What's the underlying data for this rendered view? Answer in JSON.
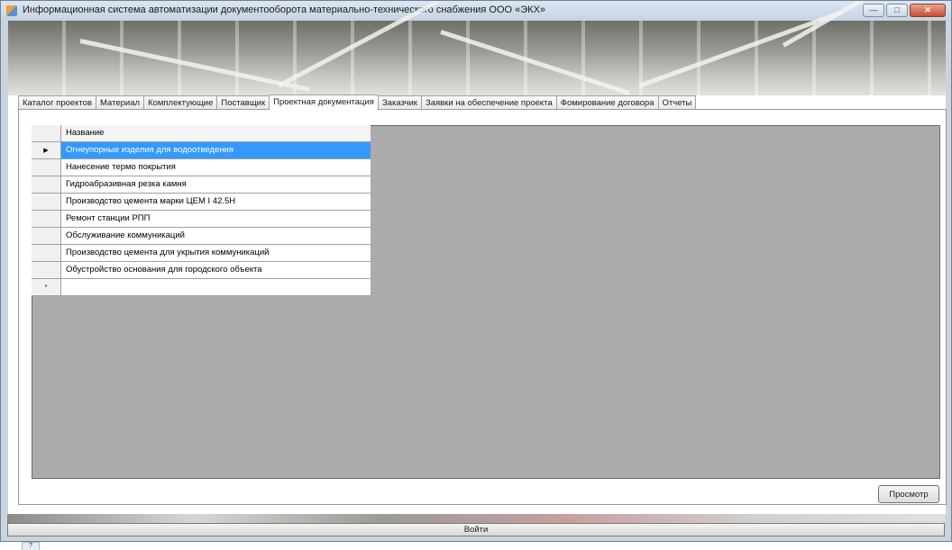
{
  "window": {
    "title": "Информационная система автоматизации документооборота материально-технического снабжения ООО «ЭКХ»"
  },
  "tabs": [
    {
      "label": "Каталог проектов"
    },
    {
      "label": "Материал"
    },
    {
      "label": "Комплектующие"
    },
    {
      "label": "Поставщик"
    },
    {
      "label": "Проектная документация"
    },
    {
      "label": "Заказчик"
    },
    {
      "label": "Заявки на обеспечение проекта"
    },
    {
      "label": "Фомирование договора"
    },
    {
      "label": "Отчеты"
    }
  ],
  "active_tab": "Проектная документация",
  "grid": {
    "column_header": "Название",
    "rows": [
      "Огнеупорные изделия для водоотведения",
      "Нанесение термо покрытия",
      "Гидроабразивная резка камня",
      "Производство цемента марки ЦЕМ I 42.5Н",
      "Ремонт станции РПП",
      "Обслуживание коммуникаций",
      "Производство цемента для укрытия коммуникаций",
      "Обустройство основания для городского объекта"
    ],
    "selected_row": 0
  },
  "buttons": {
    "view": "Просмотр",
    "login": "Войти"
  },
  "colors": {
    "selection": "#3399ff",
    "grid_background": "#ababab"
  }
}
